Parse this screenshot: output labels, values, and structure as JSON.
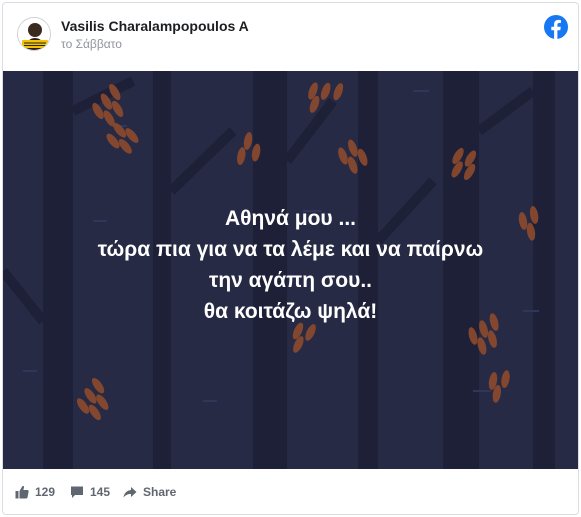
{
  "post": {
    "author": "Vasilis Charalampopoulos A",
    "timestamp": "το Σάββατο",
    "avatar_badge": "SUPPORT ART WORKERS",
    "image_text": [
      "Αθηνά μου ...",
      "τώρα πια για να τα λέμε και να παίρνω",
      "την αγάπη σου..",
      "θα κοιτάζω ψηλά!"
    ]
  },
  "footer": {
    "likes": "129",
    "comments": "145",
    "share_label": "Share"
  },
  "icons": {
    "brand": "facebook-icon",
    "like": "thumbs-up-icon",
    "comment": "speech-bubble-icon",
    "share": "share-arrow-icon"
  },
  "colors": {
    "facebook_blue": "#1877f2",
    "image_background": "#262a44",
    "leaf": "#a0522d",
    "meta_text": "#606770"
  }
}
